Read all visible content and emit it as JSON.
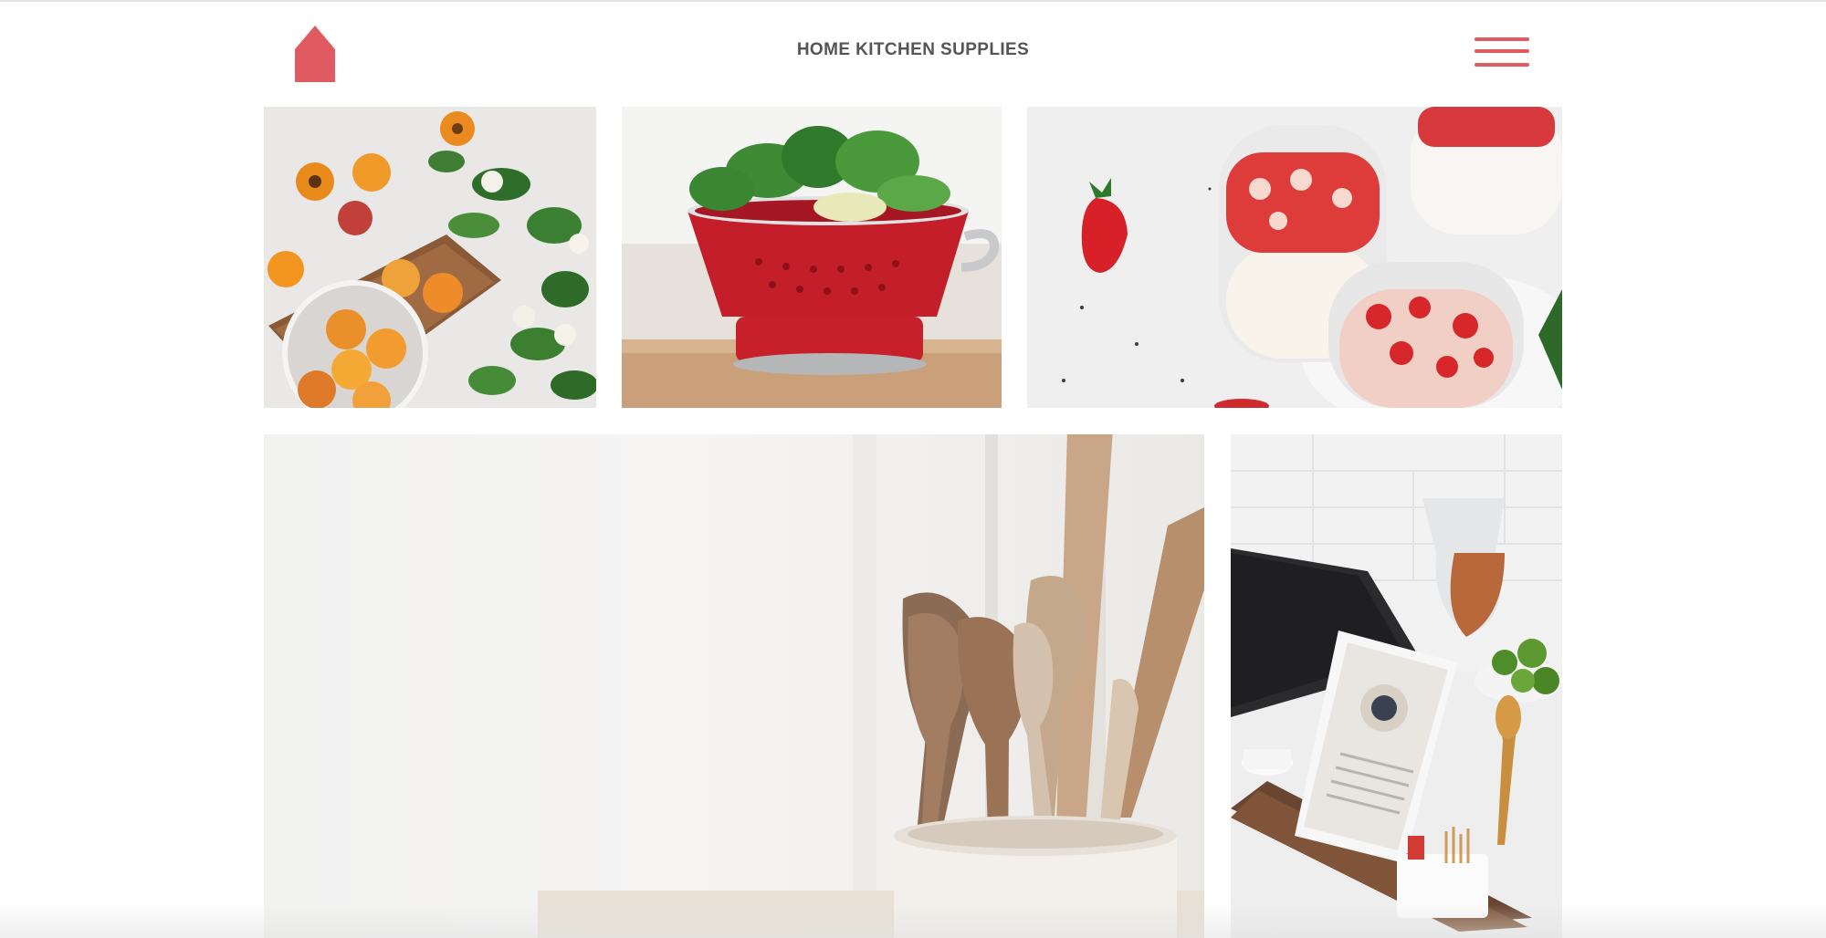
{
  "header": {
    "title": "HOME KITCHEN SUPPLIES",
    "logo_icon": "home-icon",
    "menu_icon": "hamburger-menu-icon"
  },
  "colors": {
    "accent": "#e05b61",
    "title_text": "#555555",
    "background": "#ffffff"
  },
  "gallery": {
    "images": [
      "apricots-and-flowers-on-board",
      "red-colander-with-greens",
      "strawberry-yogurt-jars",
      "wooden-spoons-in-crock",
      "tablet-on-kitchen-counter"
    ]
  }
}
